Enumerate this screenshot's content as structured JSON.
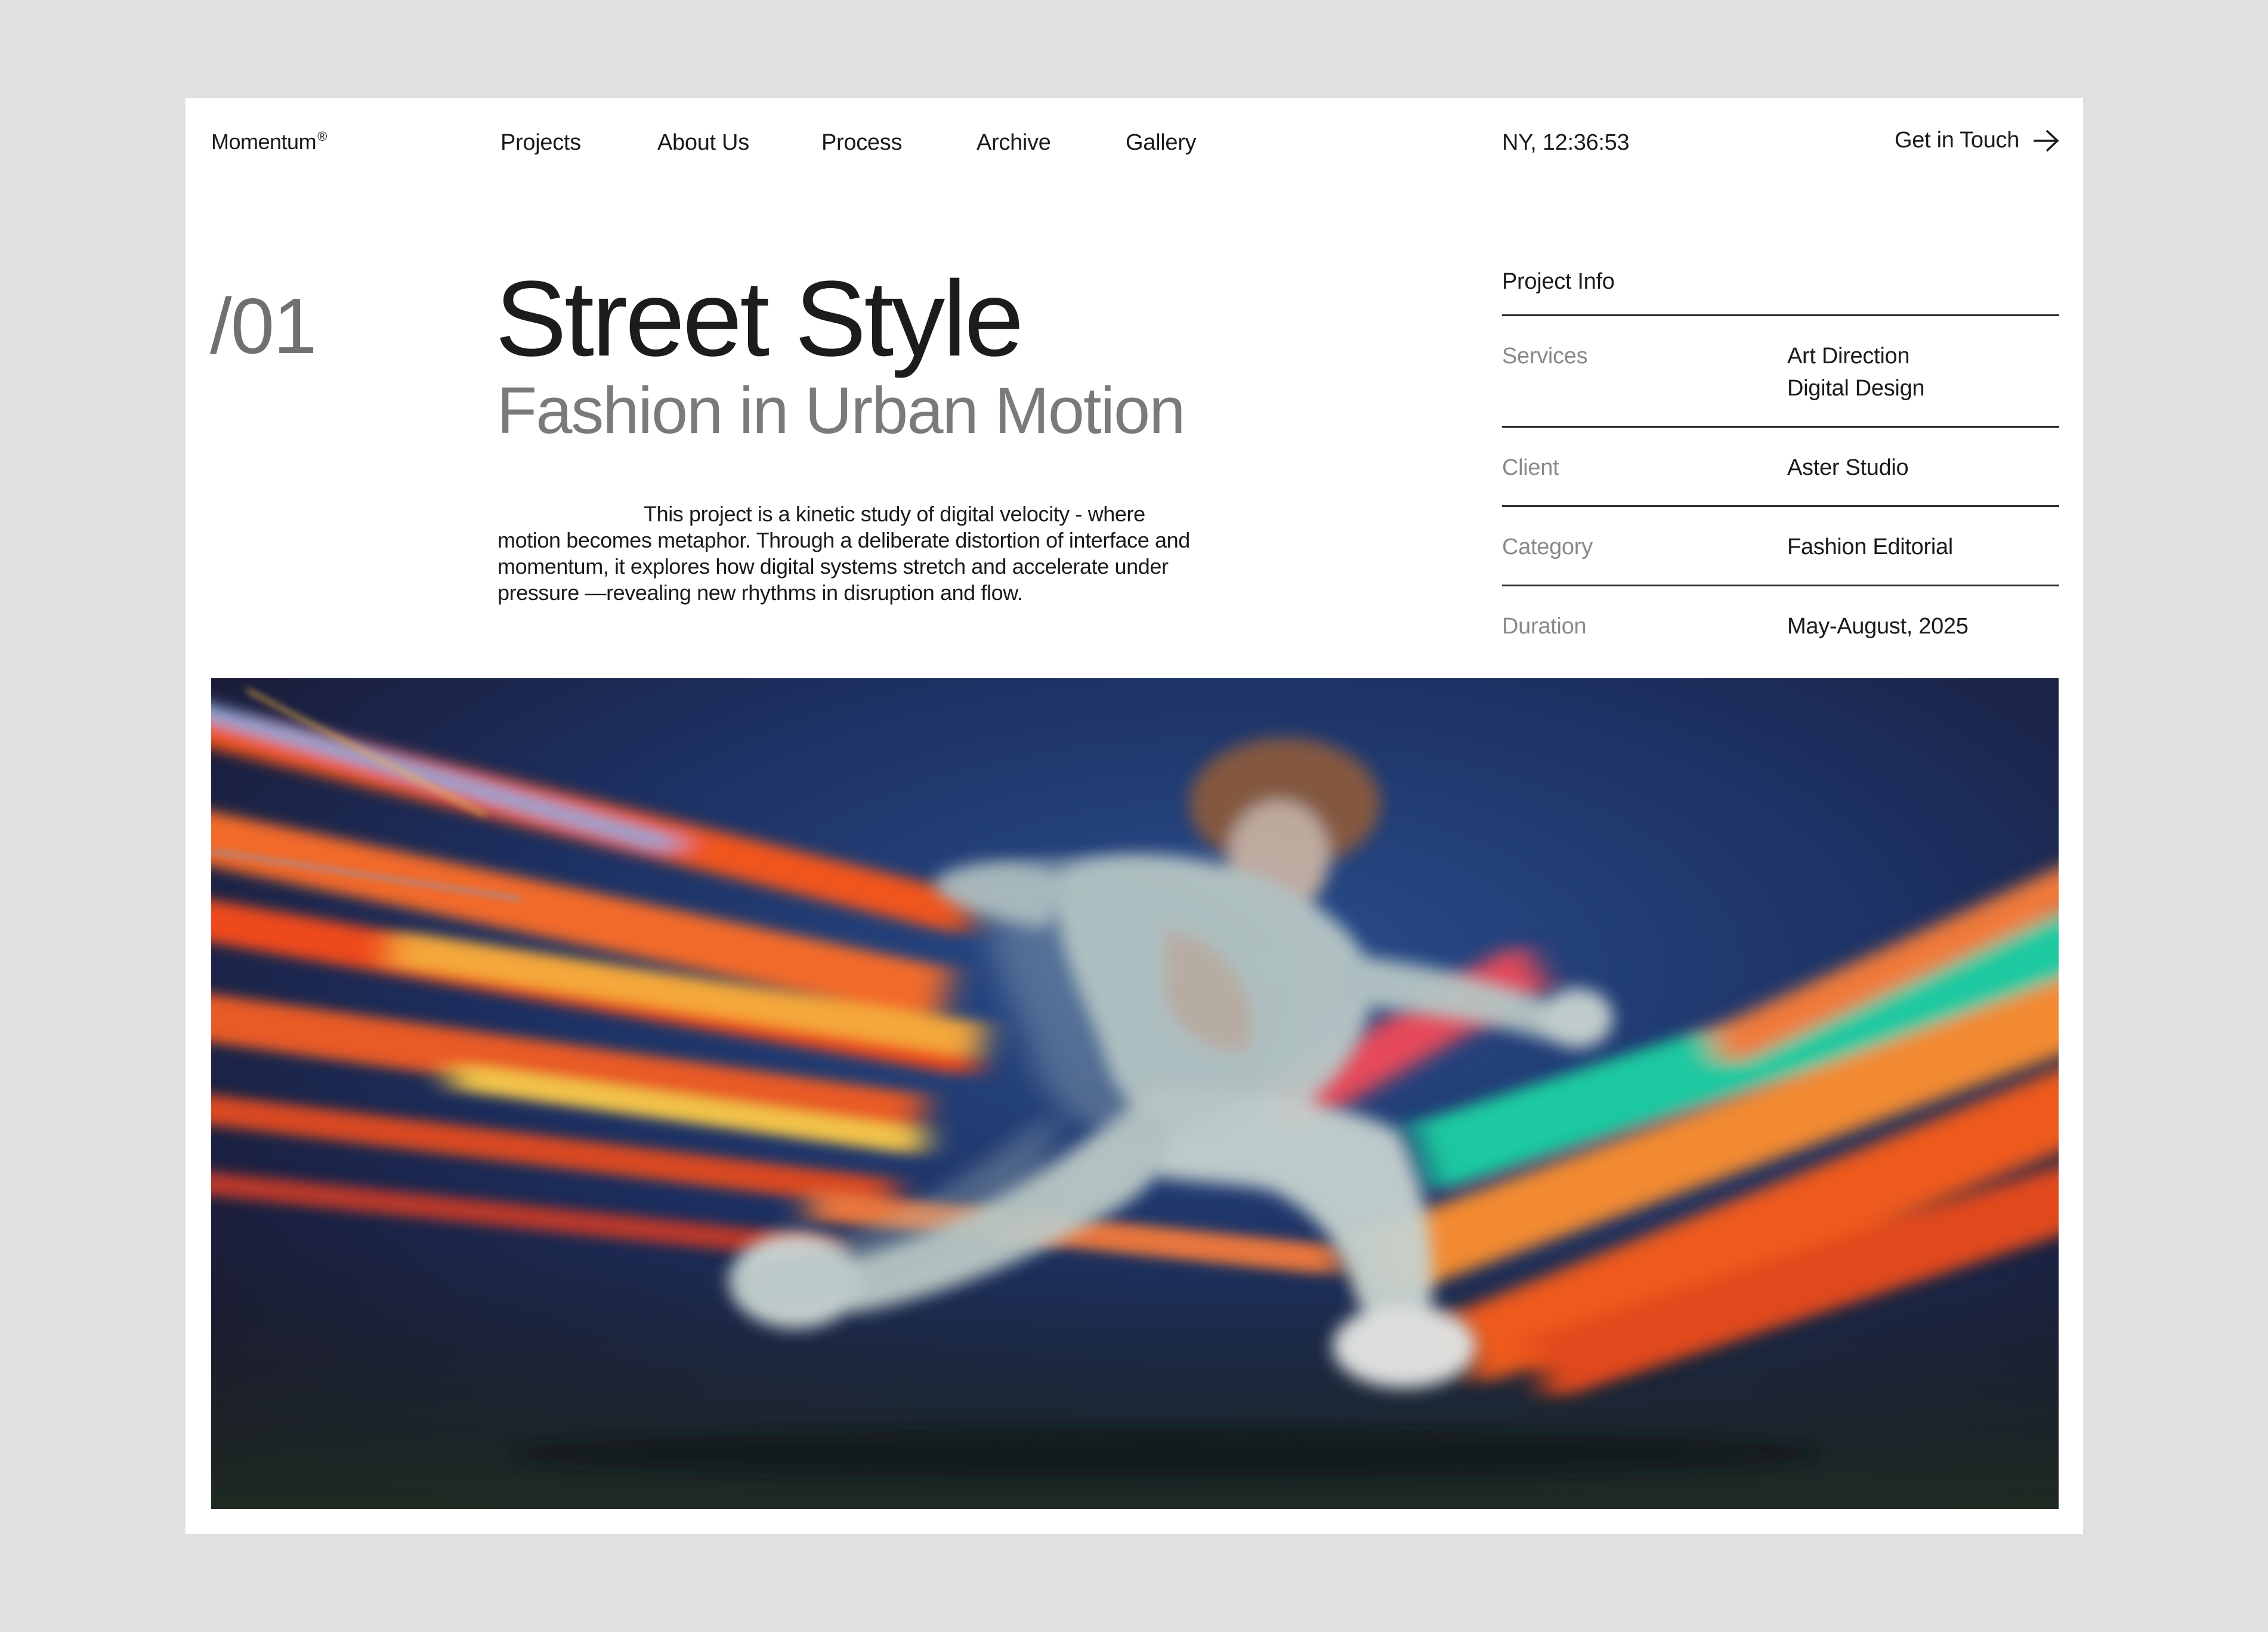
{
  "brand": {
    "name": "Momentum",
    "mark": "®"
  },
  "nav": {
    "items": [
      {
        "label": "Projects"
      },
      {
        "label": "About Us"
      },
      {
        "label": "Process"
      },
      {
        "label": "Archive"
      },
      {
        "label": "Gallery"
      }
    ]
  },
  "clock": "NY, 12:36:53",
  "cta": {
    "label": "Get in Touch",
    "icon": "arrow-right-icon"
  },
  "project": {
    "index": "/01",
    "title": "Street Style",
    "subtitle": "Fashion in Urban Motion",
    "description": "This project is a kinetic study of digital velocity - where motion becomes metaphor. Through a deliberate distortion of interface and momentum, it explores how digital systems stretch and accelerate under pressure —revealing new rhythms in disruption and flow."
  },
  "info": {
    "heading": "Project Info",
    "rows": [
      {
        "label": "Services",
        "values": [
          "Art Direction",
          "Digital Design"
        ]
      },
      {
        "label": "Client",
        "values": [
          "Aster Studio"
        ]
      },
      {
        "label": "Category",
        "values": [
          "Fashion Editorial"
        ]
      },
      {
        "label": "Duration",
        "values": [
          "May-August, 2025"
        ]
      }
    ]
  },
  "colors": {
    "page_bg": "#e2e0e3",
    "card_bg": "#ffffff",
    "text": "#1a1a1a",
    "muted": "#7a7a7a",
    "photo_blue": "#1d2f5c",
    "streak_orange": "#f05a1e"
  }
}
